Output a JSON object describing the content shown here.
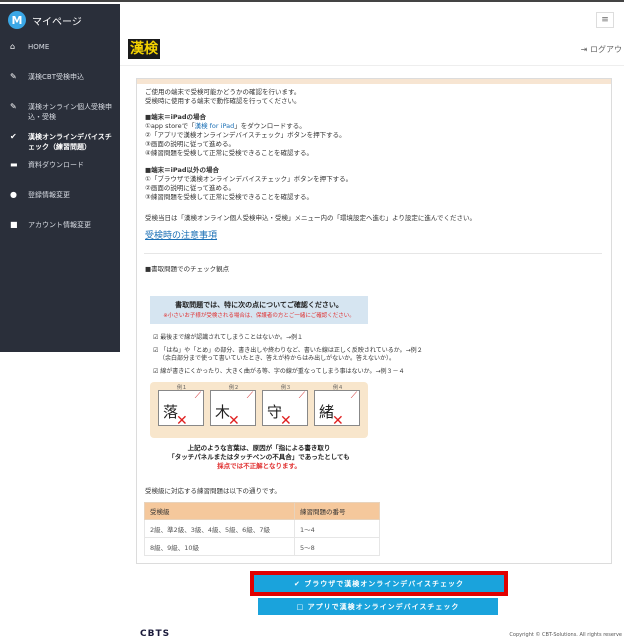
{
  "header": {
    "app_title": "マイページ",
    "brand_letter": "M",
    "menu_icon": "≡",
    "logo_text": "漢検",
    "logout": "ログアウ"
  },
  "sidebar": {
    "items": [
      {
        "label": "HOME",
        "icon": "home-icon"
      },
      {
        "label": "漢検CBT受検申込",
        "icon": "pencil-icon"
      },
      {
        "label": "漢検オンライン個人受検申込・受検",
        "icon": "pencil-icon"
      },
      {
        "label": "漢検オンラインデバイスチェック（練習問題）",
        "icon": "check-icon"
      },
      {
        "label": "資料ダウンロード",
        "icon": "folder-icon"
      },
      {
        "label": "登録情報変更",
        "icon": "user-icon"
      },
      {
        "label": "アカウント情報変更",
        "icon": "lock-icon"
      }
    ]
  },
  "content": {
    "intro1": "ご使用の端末で受検可能かどうかの確認を行います。",
    "intro2": "受検時に使用する端末で動作確認を行ってください。",
    "ipad_head": "■端末＝iPadの場合",
    "ipad_1a": "①app storeで「",
    "ipad_1link": "漢検 for iPad",
    "ipad_1b": "」をダウンロードする。",
    "ipad_2": "②「アプリで漢検オンラインデバイスチェック」ボタンを押下する。",
    "ipad_3": "③画面の説明に従って進める。",
    "ipad_4": "④練習問題を受検して正常に受検できることを確認する。",
    "other_head": "■端末＝iPad以外の場合",
    "other_1": "①「ブラウザで漢検オンラインデバイスチェック」ボタンを押下する。",
    "other_2": "②画面の説明に従って進める。",
    "other_3": "③練習問題を受検して正常に受検できることを確認する。",
    "exam_day": "受検当日は「漢検オンライン個人受検申込・受検」メニュー内の「環境設定へ進む」より設定に進んでください。",
    "caution_link": "受検時の注意事項",
    "check_head": "■書取問題でのチェック観点",
    "notice_title": "書取問題では、特に次の点についてご確認ください。",
    "notice_sub": "※小さいお子様が受検される場合は、保護者の方とご一緒にご確認ください。",
    "point1": "☑ 最後まで線が認識されてしまうことはないか。→例１",
    "point2a": "☑ 「はね」や「とめ」の部分、書き出しや終わりなど、書いた線は正しく反映されているか。→例２",
    "point2b": "（余白部分まで使って書いていたとき、答えが枠からはみ出しがないか。答えないか）。",
    "point3": "☑ 線が書きにくかったり、大きく曲がる等、字の線が重なってしまう事はないか。→例３－４",
    "ex_labels": [
      "例１",
      "例２",
      "例３",
      "例４"
    ],
    "ex_chars": [
      "落",
      "木",
      "守",
      "緒"
    ],
    "warn1": "上記のような言葉は、原因が「指による書き取り",
    "warn2": "「タッチパネルまたはタッチペンの不具合」であったとしても",
    "warn3": "採点では不正解となります。",
    "table_intro": "受検級に対応する練習問題は以下の通りです。",
    "table": {
      "headers": [
        "受検級",
        "練習問題の番号"
      ],
      "rows": [
        [
          "2級、準2級、3級、4級、5級、6級、7級",
          "1～4"
        ],
        [
          "8級、9級、10級",
          "5～8"
        ]
      ]
    }
  },
  "buttons": {
    "browser": "✔ ブラウザで漢検オンラインデバイスチェック",
    "app": "□ アプリで漢検オンラインデバイスチェック"
  },
  "footer": {
    "logo": "CBTS",
    "copyright": "Copyright © CBT-Solutions. All rights reserve"
  },
  "colors": {
    "sidebar_bg": "#2a2f3a",
    "button_bg": "#1aa3dc",
    "highlight": "#e10000",
    "table_header": "#f5c89c"
  }
}
